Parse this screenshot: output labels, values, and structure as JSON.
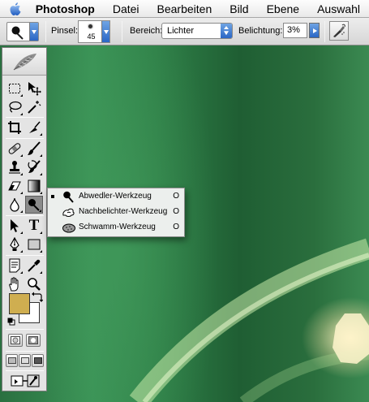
{
  "menubar": {
    "apple_icon": "apple-logo-icon",
    "app_name": "Photoshop",
    "items": [
      "Datei",
      "Bearbeiten",
      "Bild",
      "Ebene",
      "Auswahl"
    ]
  },
  "options": {
    "tool_preset_icon": "dodge-tool-icon",
    "brush_label": "Pinsel:",
    "brush_size": "45",
    "range_label": "Bereich:",
    "range_value": "Lichter",
    "exposure_label": "Belichtung:",
    "exposure_value": "3%",
    "airbrush_icon": "airbrush-icon"
  },
  "toolbox": {
    "logo_icon": "feather-logo-icon",
    "tools": [
      "marquee-tool",
      "move-tool",
      "lasso-tool",
      "magic-wand-tool",
      "crop-tool",
      "slice-tool",
      "healing-brush-tool",
      "brush-tool",
      "clone-stamp-tool",
      "history-brush-tool",
      "eraser-tool",
      "gradient-tool",
      "blur-tool",
      "dodge-tool",
      "path-selection-tool",
      "type-tool",
      "pen-tool",
      "rectangle-tool",
      "notes-tool",
      "eyedropper-tool",
      "hand-tool",
      "zoom-tool"
    ],
    "active_tool": "dodge-tool",
    "type_glyph": "T",
    "foreground_color": "#cfae50",
    "background_color": "#ffffff"
  },
  "flyout": {
    "items": [
      {
        "label": "Abwedler-Werkzeug",
        "shortcut": "O",
        "selected": true,
        "icon": "dodge-icon"
      },
      {
        "label": "Nachbelichter-Werkzeug",
        "shortcut": "O",
        "selected": false,
        "icon": "burn-icon"
      },
      {
        "label": "Schwamm-Werkzeug",
        "shortcut": "O",
        "selected": false,
        "icon": "sponge-icon"
      }
    ]
  }
}
